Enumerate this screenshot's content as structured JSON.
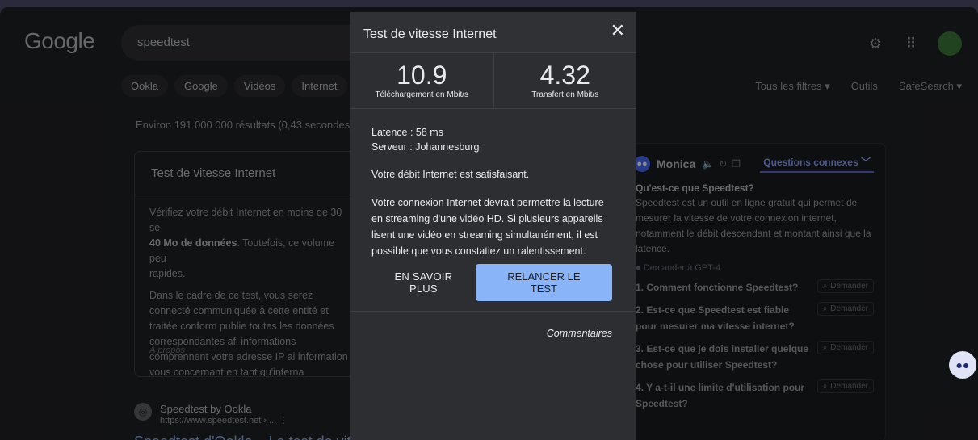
{
  "google": {
    "logo": "Google",
    "query": "speedtest",
    "tabs": [
      "Ookla",
      "Google",
      "Vidéos",
      "Internet"
    ],
    "tools": [
      "Tous les filtres ▾",
      "Outils",
      "SafeSearch ▾"
    ],
    "stats": "Environ 191 000 000 résultats (0,43 secondes)"
  },
  "card": {
    "title": "Test de vitesse Internet",
    "p1_a": "Vérifiez votre débit Internet en moins de 30 se",
    "p1_bold": "40 Mo de données",
    "p1_b": ". Toutefois, ce volume peu",
    "p1_c": "rapides.",
    "p2": "Dans le cadre de ce test, vous serez connecté communiquée à cette entité et traitée conform publie toutes les données correspondantes afi informations comprennent votre adresse IP ai information vous concernant en tant qu'interna",
    "about": "À propos"
  },
  "result": {
    "favicon": "◎",
    "name": "Speedtest by Ookla",
    "url": "https://www.speedtest.net › ...  ⋮",
    "title": "Speedtest d'Ookla – Le test de vites"
  },
  "monica": {
    "logo": "●●",
    "name": "Monica",
    "icons": [
      "🔈",
      "↻",
      "❐"
    ],
    "tab": "Questions connexes ﹀",
    "q1": "Qu'est-ce que Speedtest?",
    "a1": "Speedtest est un outil en ligne gratuit qui permet de mesurer la vitesse de votre connexion internet, notamment le débit descendant et montant ainsi que la latence.",
    "gpt": "● Demander à GPT-4",
    "ask": "Demander",
    "items": [
      "1. Comment fonctionne Speedtest?",
      "2. Est-ce que Speedtest est fiable pour mesurer ma vitesse internet?",
      "3. Est-ce que je dois installer quelque chose pour utiliser Speedtest?",
      "4. Y a-t-il une limite d'utilisation pour Speedtest?"
    ],
    "float": "●●"
  },
  "dialog": {
    "title": "Test de vitesse Internet",
    "close": "✕",
    "download_value": "10.9",
    "download_label": "Téléchargement en Mbit/s",
    "upload_value": "4.32",
    "upload_label": "Transfert en Mbit/s",
    "latency_label": "Latence : ",
    "latency_value": "58 ms",
    "server_label": "Serveur : ",
    "server_value": "Johannesburg",
    "verdict": "Votre débit Internet est satisfaisant.",
    "description": "Votre connexion Internet devrait permettre la lecture en streaming d'une vidéo HD. Si plusieurs appareils lisent une vidéo en streaming simultanément, il est possible que vous constatiez un ralentissement.",
    "learn_more": "EN SAVOIR PLUS",
    "rerun": "RELANCER LE TEST",
    "comments": "Commentaires"
  },
  "colors": {
    "accent": "#8ab4f8",
    "dialog_bg": "#2d2e31",
    "page_bg": "#202124"
  }
}
